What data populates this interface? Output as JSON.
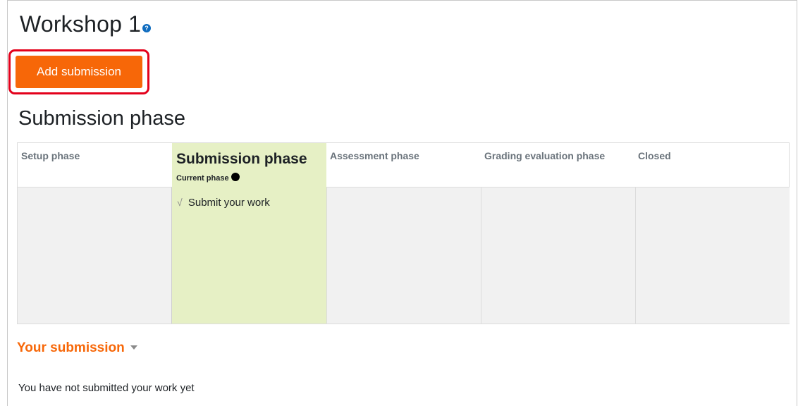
{
  "page": {
    "title": "Workshop 1",
    "help_icon_glyph": "?"
  },
  "actions": {
    "add_submission_label": "Add submission"
  },
  "current_phase_heading": "Submission phase",
  "phases": [
    {
      "name": "Setup phase",
      "current": false,
      "tasks": []
    },
    {
      "name": "Submission phase",
      "current": true,
      "current_label": "Current phase",
      "tasks": [
        {
          "label": "Submit your work",
          "icon": "check-icon"
        }
      ]
    },
    {
      "name": "Assessment phase",
      "current": false,
      "tasks": []
    },
    {
      "name": "Grading evaluation phase",
      "current": false,
      "tasks": []
    },
    {
      "name": "Closed",
      "current": false,
      "tasks": []
    }
  ],
  "your_submission": {
    "heading": "Your submission",
    "status": "You have not submitted your work yet"
  },
  "colors": {
    "accent": "#f76708",
    "highlight_ring": "#e3001b",
    "current_phase_bg": "#e6f0c5",
    "phase_body_bg": "#f1f1f1",
    "help_icon": "#0f6cbf"
  },
  "icons": {
    "check": "√"
  }
}
